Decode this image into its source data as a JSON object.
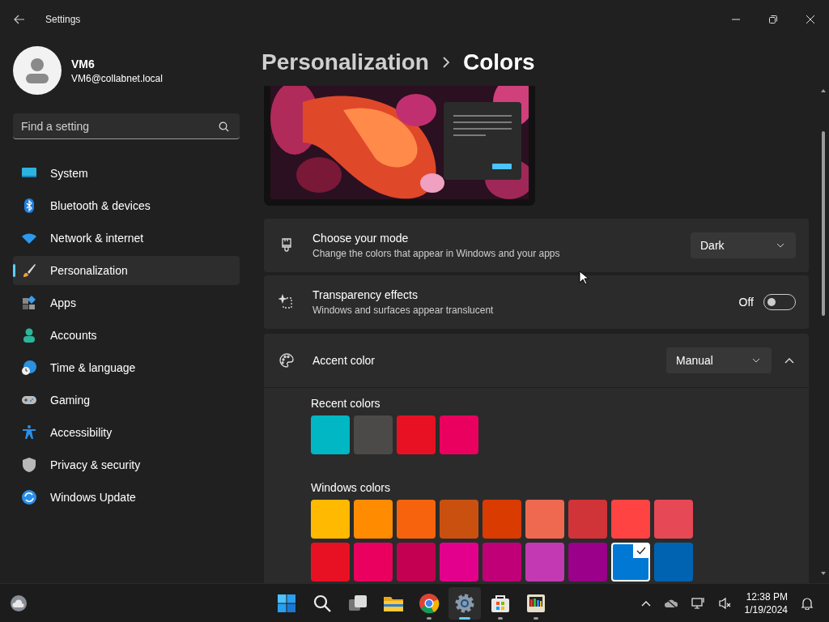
{
  "window": {
    "title": "Settings"
  },
  "user": {
    "name": "VM6",
    "email": "VM6@collabnet.local"
  },
  "search": {
    "placeholder": "Find a setting"
  },
  "nav": [
    {
      "label": "System",
      "selected": false
    },
    {
      "label": "Bluetooth & devices",
      "selected": false
    },
    {
      "label": "Network & internet",
      "selected": false
    },
    {
      "label": "Personalization",
      "selected": true
    },
    {
      "label": "Apps",
      "selected": false
    },
    {
      "label": "Accounts",
      "selected": false
    },
    {
      "label": "Time & language",
      "selected": false
    },
    {
      "label": "Gaming",
      "selected": false
    },
    {
      "label": "Accessibility",
      "selected": false
    },
    {
      "label": "Privacy & security",
      "selected": false
    },
    {
      "label": "Windows Update",
      "selected": false
    }
  ],
  "breadcrumb": {
    "parent": "Personalization",
    "current": "Colors"
  },
  "settings": [
    {
      "kind": "dropdown",
      "title": "Choose your mode",
      "description": "Change the colors that appear in Windows and your apps",
      "value": "Dark"
    },
    {
      "kind": "toggle",
      "title": "Transparency effects",
      "description": "Windows and surfaces appear translucent",
      "state_label": "Off",
      "on": false
    },
    {
      "kind": "expander",
      "title": "Accent color",
      "value": "Manual",
      "expanded": true
    }
  ],
  "recent_colors": {
    "label": "Recent colors",
    "items": [
      {
        "color": "#00b7c3"
      },
      {
        "color": "#4c4a48"
      },
      {
        "color": "#e81123"
      },
      {
        "color": "#ea005e"
      }
    ]
  },
  "windows_colors": {
    "label": "Windows colors",
    "items": [
      {
        "color": "#ffb900",
        "selected": false
      },
      {
        "color": "#ff8c00",
        "selected": false
      },
      {
        "color": "#f7630c",
        "selected": false
      },
      {
        "color": "#ca5010",
        "selected": false
      },
      {
        "color": "#da3b01",
        "selected": false
      },
      {
        "color": "#ef6950",
        "selected": false
      },
      {
        "color": "#d13438",
        "selected": false
      },
      {
        "color": "#ff4343",
        "selected": false
      },
      {
        "color": "#e74856",
        "selected": false
      },
      {
        "color": "#e81123",
        "selected": false
      },
      {
        "color": "#ea005e",
        "selected": false
      },
      {
        "color": "#c30052",
        "selected": false
      },
      {
        "color": "#e3008c",
        "selected": false
      },
      {
        "color": "#bf0077",
        "selected": false
      },
      {
        "color": "#c239b3",
        "selected": false
      },
      {
        "color": "#9a0089",
        "selected": false
      },
      {
        "color": "#0078d4",
        "selected": true
      },
      {
        "color": "#0063b1",
        "selected": false
      }
    ]
  },
  "taskbar": {
    "apps": [
      {
        "running": false,
        "selected": false
      },
      {
        "running": false,
        "selected": false
      },
      {
        "running": false,
        "selected": false
      },
      {
        "running": false,
        "selected": false
      },
      {
        "running": true,
        "selected": false
      },
      {
        "running": true,
        "selected": true
      },
      {
        "running": true,
        "selected": false
      },
      {
        "running": true,
        "selected": false
      }
    ],
    "time": "12:38 PM",
    "date": "1/19/2024"
  }
}
